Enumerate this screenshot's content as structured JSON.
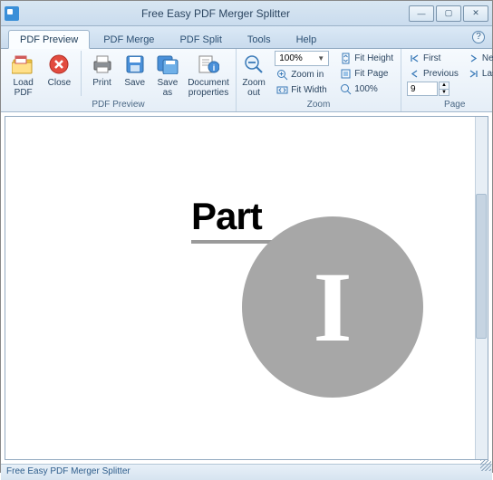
{
  "app": {
    "title": "Free Easy PDF Merger Splitter"
  },
  "window": {
    "min": "—",
    "max": "▢",
    "close": "✕"
  },
  "tabs": [
    "PDF Preview",
    "PDF Merge",
    "PDF Split",
    "Tools",
    "Help"
  ],
  "ribbon": {
    "preview": {
      "label": "PDF Preview",
      "load": "Load\nPDF",
      "close": "Close",
      "print": "Print",
      "save": "Save",
      "saveas": "Save\nas",
      "docprops": "Document\nproperties"
    },
    "zoom": {
      "label": "Zoom",
      "zoomout": "Zoom\nout",
      "level": "100%",
      "zoomin": "Zoom in",
      "fitwidth": "Fit Width",
      "fitheight": "Fit Height",
      "fitpage": "Fit Page",
      "pct100": "100%"
    },
    "page": {
      "label": "Page",
      "first": "First",
      "prev": "Previous",
      "current": "9",
      "next": "Next",
      "last": "Last"
    }
  },
  "doc": {
    "part_label": "Part",
    "part_number": "I"
  },
  "status": {
    "text": "Free Easy PDF Merger Splitter"
  }
}
